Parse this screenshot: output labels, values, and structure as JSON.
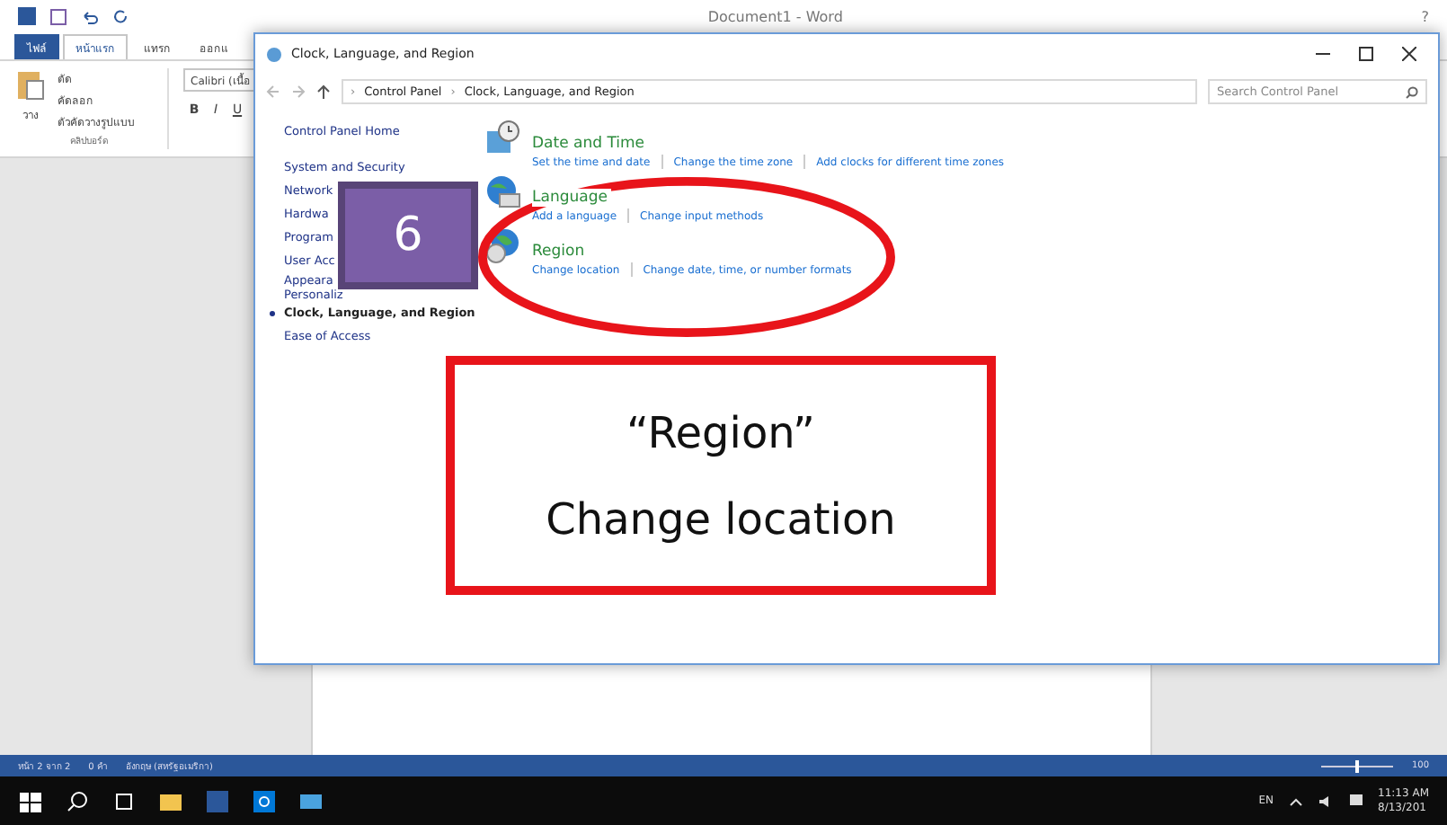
{
  "word": {
    "title": "Document1 - Word",
    "help": "?",
    "tabs": [
      {
        "label": "ไฟล์",
        "kind": "file",
        "selected": false
      },
      {
        "label": "หน้าแรก",
        "kind": "tab",
        "selected": true
      },
      {
        "label": "แทรก",
        "kind": "tab",
        "selected": false
      },
      {
        "label": "ออกแ",
        "kind": "tab",
        "selected": false
      }
    ],
    "clipboard": {
      "paste": "วาง",
      "cut": "ตัด",
      "copy": "คัดลอก",
      "format_painter": "ตัวคัดวางรูปแบบ",
      "group": "คลิปบอร์ด"
    },
    "font": {
      "name": "Calibri (เนื้อ",
      "buttons": [
        "B",
        "I",
        "U"
      ]
    },
    "status_bar": {
      "page": "หน้า 2 จาก 2",
      "words": "0 คำ",
      "language": "อังกฤษ (สหรัฐอเมริกา)",
      "zoom": "100",
      "level": 0.5
    }
  },
  "control_panel": {
    "title": "Clock, Language, and Region",
    "breadcrumb": [
      {
        "separator": "›",
        "label": "Control Panel"
      },
      {
        "separator": "›",
        "label": "Clock, Language, and Region"
      }
    ],
    "search": {
      "placeholder": "Search Control Panel"
    },
    "sidebar": [
      {
        "label": "Control Panel Home",
        "selected": false
      },
      {
        "label": "System and Security",
        "selected": false
      },
      {
        "label": "Network",
        "selected": false
      },
      {
        "label": "Hardwa",
        "selected": false
      },
      {
        "label": "Program",
        "selected": false
      },
      {
        "label": "User Acc",
        "selected": false
      },
      {
        "label": "Appeara",
        "selected": false
      },
      {
        "label": "Personaliz",
        "selected": false
      },
      {
        "label": "Clock, Language, and Region",
        "selected": true
      },
      {
        "label": "Ease of Access",
        "selected": false
      }
    ],
    "categories": [
      {
        "kind": "clock",
        "title": "Date and Time",
        "links": [
          "Set the time and date",
          "Change the time zone",
          "Add clocks for different time zones"
        ]
      },
      {
        "kind": "language",
        "title": "Language",
        "links": [
          "Add a language",
          "Change input methods"
        ]
      },
      {
        "kind": "globe",
        "title": "Region",
        "links": [
          "Change location",
          "Change date, time, or number formats"
        ]
      }
    ]
  },
  "annotation": {
    "step": "6",
    "callout": [
      "“Region”",
      "Change location"
    ]
  },
  "taskbar": {
    "language": "EN",
    "time": "11:13 AM",
    "date": "8/13/201"
  }
}
